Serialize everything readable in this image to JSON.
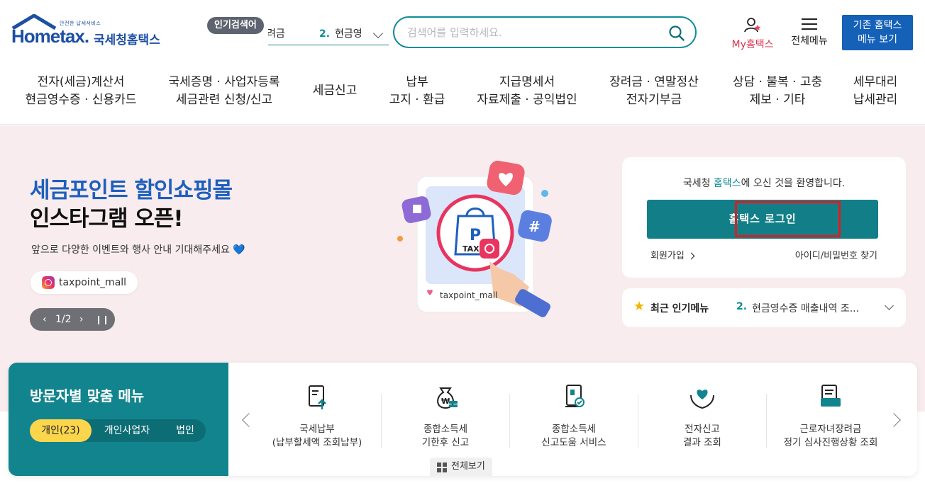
{
  "header": {
    "logo_small": "안전한 납세서비스",
    "logo_main": "Hometax.",
    "logo_kr": "국세청홈택스",
    "popular_tag": "인기검색어",
    "popular_prev": "려금",
    "popular_num": "2.",
    "popular_text": "현금영",
    "search_placeholder": "검색어를 입력하세요.",
    "my_hometax": "My홈택스",
    "all_menu": "전체메뉴",
    "old_menu_line1": "기존 홈택스",
    "old_menu_line2": "메뉴 보기"
  },
  "gnb": [
    {
      "l1": "전자(세금)계산서",
      "l2": "현금영수증 · 신용카드"
    },
    {
      "l1": "국세증명 · 사업자등록",
      "l2": "세금관련 신청/신고"
    },
    {
      "l1": "세금신고",
      "l2": ""
    },
    {
      "l1": "납부",
      "l2": "고지 · 환급"
    },
    {
      "l1": "지급명세서",
      "l2": "자료제출 · 공익법인"
    },
    {
      "l1": "장려금 · 연말정산",
      "l2": "전자기부금"
    },
    {
      "l1": "상담 · 불복 · 고충",
      "l2": "제보 · 기타"
    },
    {
      "l1": "세무대리",
      "l2": "납세관리"
    }
  ],
  "hero": {
    "title1": "세금포인트 할인쇼핑몰",
    "title2": "인스타그램 오픈!",
    "subtitle": "앞으로 다양한 이벤트와 행사 안내 기대해주세요 💙",
    "insta_handle": "taxpoint_mall",
    "illust_handle": "taxpoint_mall",
    "pager": "1/2",
    "bag_letter": "P",
    "bag_text": "TAX"
  },
  "login": {
    "welcome_pre": "국세청 ",
    "welcome_hl": "홈택스",
    "welcome_post": "에 오신 것을 환영합니다.",
    "login_button": "홈택스 로그인",
    "join": "회원가입",
    "find": "아이디/비밀번호 찾기"
  },
  "recent": {
    "title": "최근 인기메뉴",
    "num": "2.",
    "text": "현금영수증 매출내역 조..."
  },
  "visitor": {
    "title": "방문자별 맞춤 메뉴",
    "tabs": [
      "개인(23)",
      "개인사업자",
      "법인"
    ],
    "cards": [
      {
        "l1": "국세납부",
        "l2": "(납부할세액 조회납부)"
      },
      {
        "l1": "종합소득세",
        "l2": "기한후 신고"
      },
      {
        "l1": "종합소득세",
        "l2": "신고도움 서비스"
      },
      {
        "l1": "전자신고",
        "l2": "결과 조회"
      },
      {
        "l1": "근로자녀장려금",
        "l2": "정기 심사진행상황 조회"
      }
    ],
    "view_all": "전체보기"
  },
  "colors": {
    "brand_blue": "#1d4fa3",
    "teal": "#127f88",
    "hero_bg": "#f8ecee",
    "highlight_red": "#e31a1a",
    "tab_active": "#fbd64c"
  }
}
